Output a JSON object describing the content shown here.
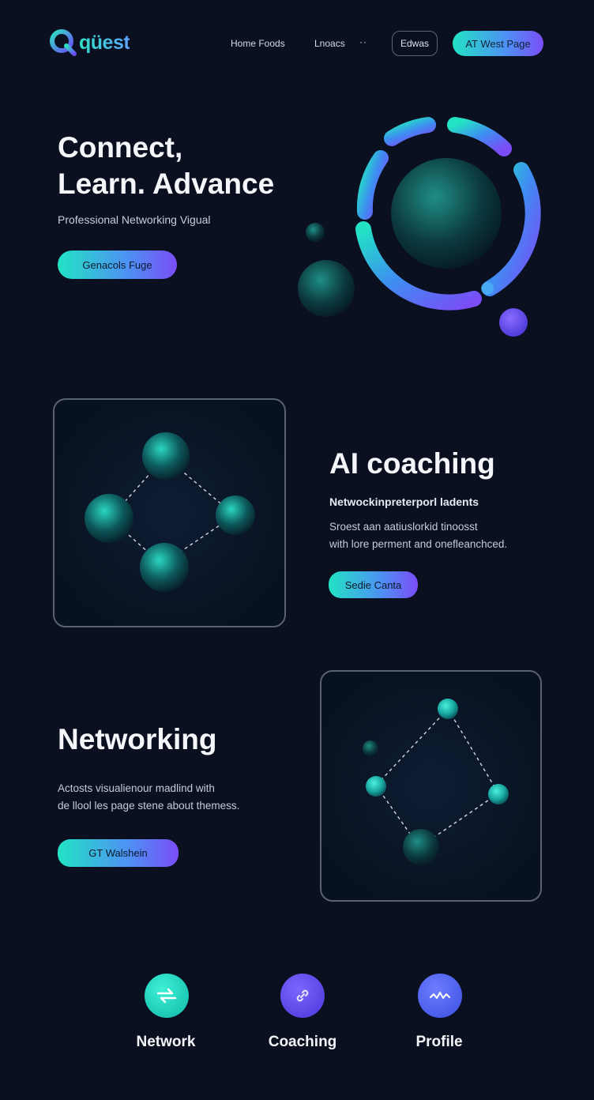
{
  "brand": {
    "name": "qüest"
  },
  "nav": {
    "links": [
      "Home Foods",
      "Lnoacs"
    ],
    "more": "··",
    "outline_button": "Edwas",
    "cta_button": "AT West Page"
  },
  "hero": {
    "title_line1": "Connect,",
    "title_line2": "Learn. Advance",
    "subtitle": "Professional Networking Vigual",
    "button": "Genacols Fuge"
  },
  "coaching": {
    "title": "AI coaching",
    "subtitle": "Netwockinpreterporl ladents",
    "body_line1": "Sroest aan aatiuslorkid tinoosst",
    "body_line2": "with lore perment and onefleanchced.",
    "button": "Sedie Canta"
  },
  "networking": {
    "title": "Networking",
    "body_line1": "Actosts visualienour madlind with",
    "body_line2": "de llool les page stene about themess.",
    "button": "GT Walshein"
  },
  "features": [
    {
      "label": "Network",
      "icon": "network-icon",
      "color": "#1fd6c0"
    },
    {
      "label": "Coaching",
      "icon": "link-icon",
      "color": "#5b49e8"
    },
    {
      "label": "Profile",
      "icon": "wave-icon",
      "color": "#4a64f0"
    }
  ],
  "colors": {
    "background": "#0a1020",
    "accent_teal": "#22e3c4",
    "accent_violet": "#7a4df6"
  }
}
